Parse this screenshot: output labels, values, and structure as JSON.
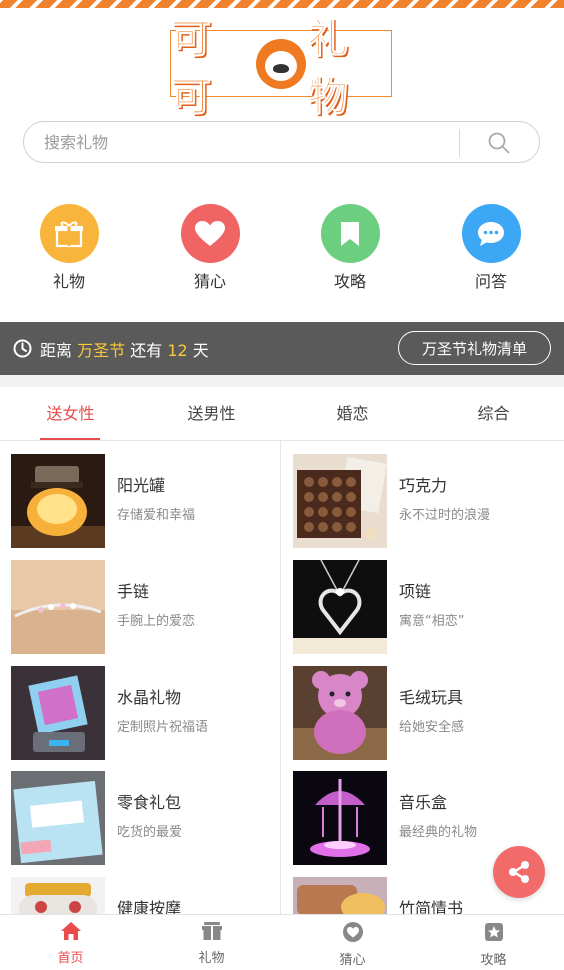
{
  "header": {
    "logo_text_left": "可可",
    "logo_text_right": "礼物"
  },
  "search": {
    "placeholder": "搜索礼物"
  },
  "categories": [
    {
      "label": "礼物",
      "color": "#f9b53b",
      "icon": "gift-icon"
    },
    {
      "label": "猜心",
      "color": "#f06464",
      "icon": "heart-icon"
    },
    {
      "label": "攻略",
      "color": "#6ccf80",
      "icon": "bookmark-icon"
    },
    {
      "label": "问答",
      "color": "#3ca7f5",
      "icon": "chat-bubble-icon"
    }
  ],
  "countdown": {
    "prefix": "距离",
    "holiday": "万圣节",
    "middle": "还有",
    "days": "12",
    "suffix": "天",
    "button_label": "万圣节礼物清单"
  },
  "tabs": [
    {
      "label": "送女性",
      "active": true
    },
    {
      "label": "送男性",
      "active": false
    },
    {
      "label": "婚恋",
      "active": false
    },
    {
      "label": "综合",
      "active": false
    }
  ],
  "products": [
    {
      "title": "阳光罐",
      "desc": "存储爱和幸福"
    },
    {
      "title": "巧克力",
      "desc": "永不过时的浪漫"
    },
    {
      "title": "手链",
      "desc": "手腕上的爱恋"
    },
    {
      "title": "项链",
      "desc": "寓意“相恋”"
    },
    {
      "title": "水晶礼物",
      "desc": "定制照片祝福语"
    },
    {
      "title": "毛绒玩具",
      "desc": "给她安全感"
    },
    {
      "title": "零食礼包",
      "desc": "吃货的最爱"
    },
    {
      "title": "音乐盒",
      "desc": "最经典的礼物"
    },
    {
      "title": "健康按摩",
      "desc": ""
    },
    {
      "title": "竹简情书",
      "desc": ""
    }
  ],
  "bottom_nav": [
    {
      "label": "首页",
      "icon": "home-icon",
      "active": true
    },
    {
      "label": "礼物",
      "icon": "gift-icon",
      "active": false
    },
    {
      "label": "猜心",
      "icon": "heart-icon",
      "active": false
    },
    {
      "label": "攻略",
      "icon": "guide-icon",
      "active": false
    }
  ],
  "colors": {
    "accent": "#e94c4c",
    "logo": "#f07a22",
    "highlight": "#f9c93a",
    "countdown_bg": "#5a5a5a"
  }
}
